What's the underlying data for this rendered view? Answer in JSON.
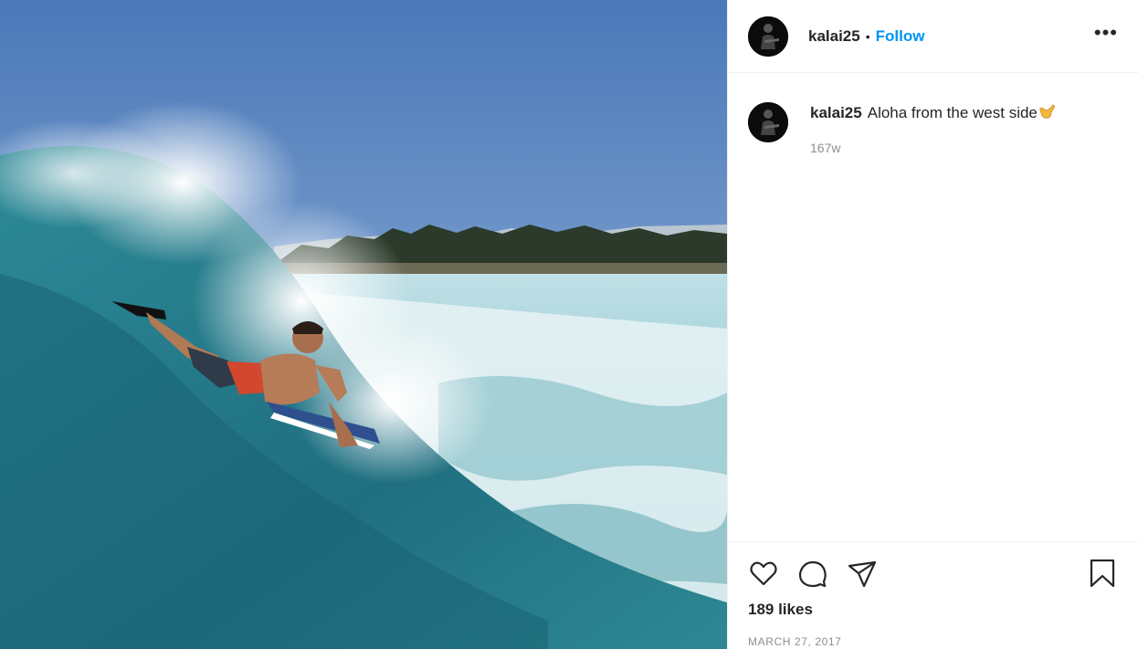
{
  "post": {
    "username": "kalai25",
    "separator": "•",
    "follow_label": "Follow",
    "more_label": "•••",
    "caption": {
      "username": "kalai25",
      "text": "Aloha from the west side",
      "age": "167w"
    },
    "likes": "189 likes",
    "date": "MARCH 27, 2017"
  },
  "icons": {
    "like": "heart-outline-icon",
    "comment": "speech-bubble-icon",
    "share": "paper-plane-icon",
    "save": "bookmark-icon",
    "caption_emoji": "shaka-hand-emoji"
  },
  "colors": {
    "link": "#0095f6",
    "text": "#262626",
    "muted": "#8e8e8e",
    "border": "#efefef"
  }
}
